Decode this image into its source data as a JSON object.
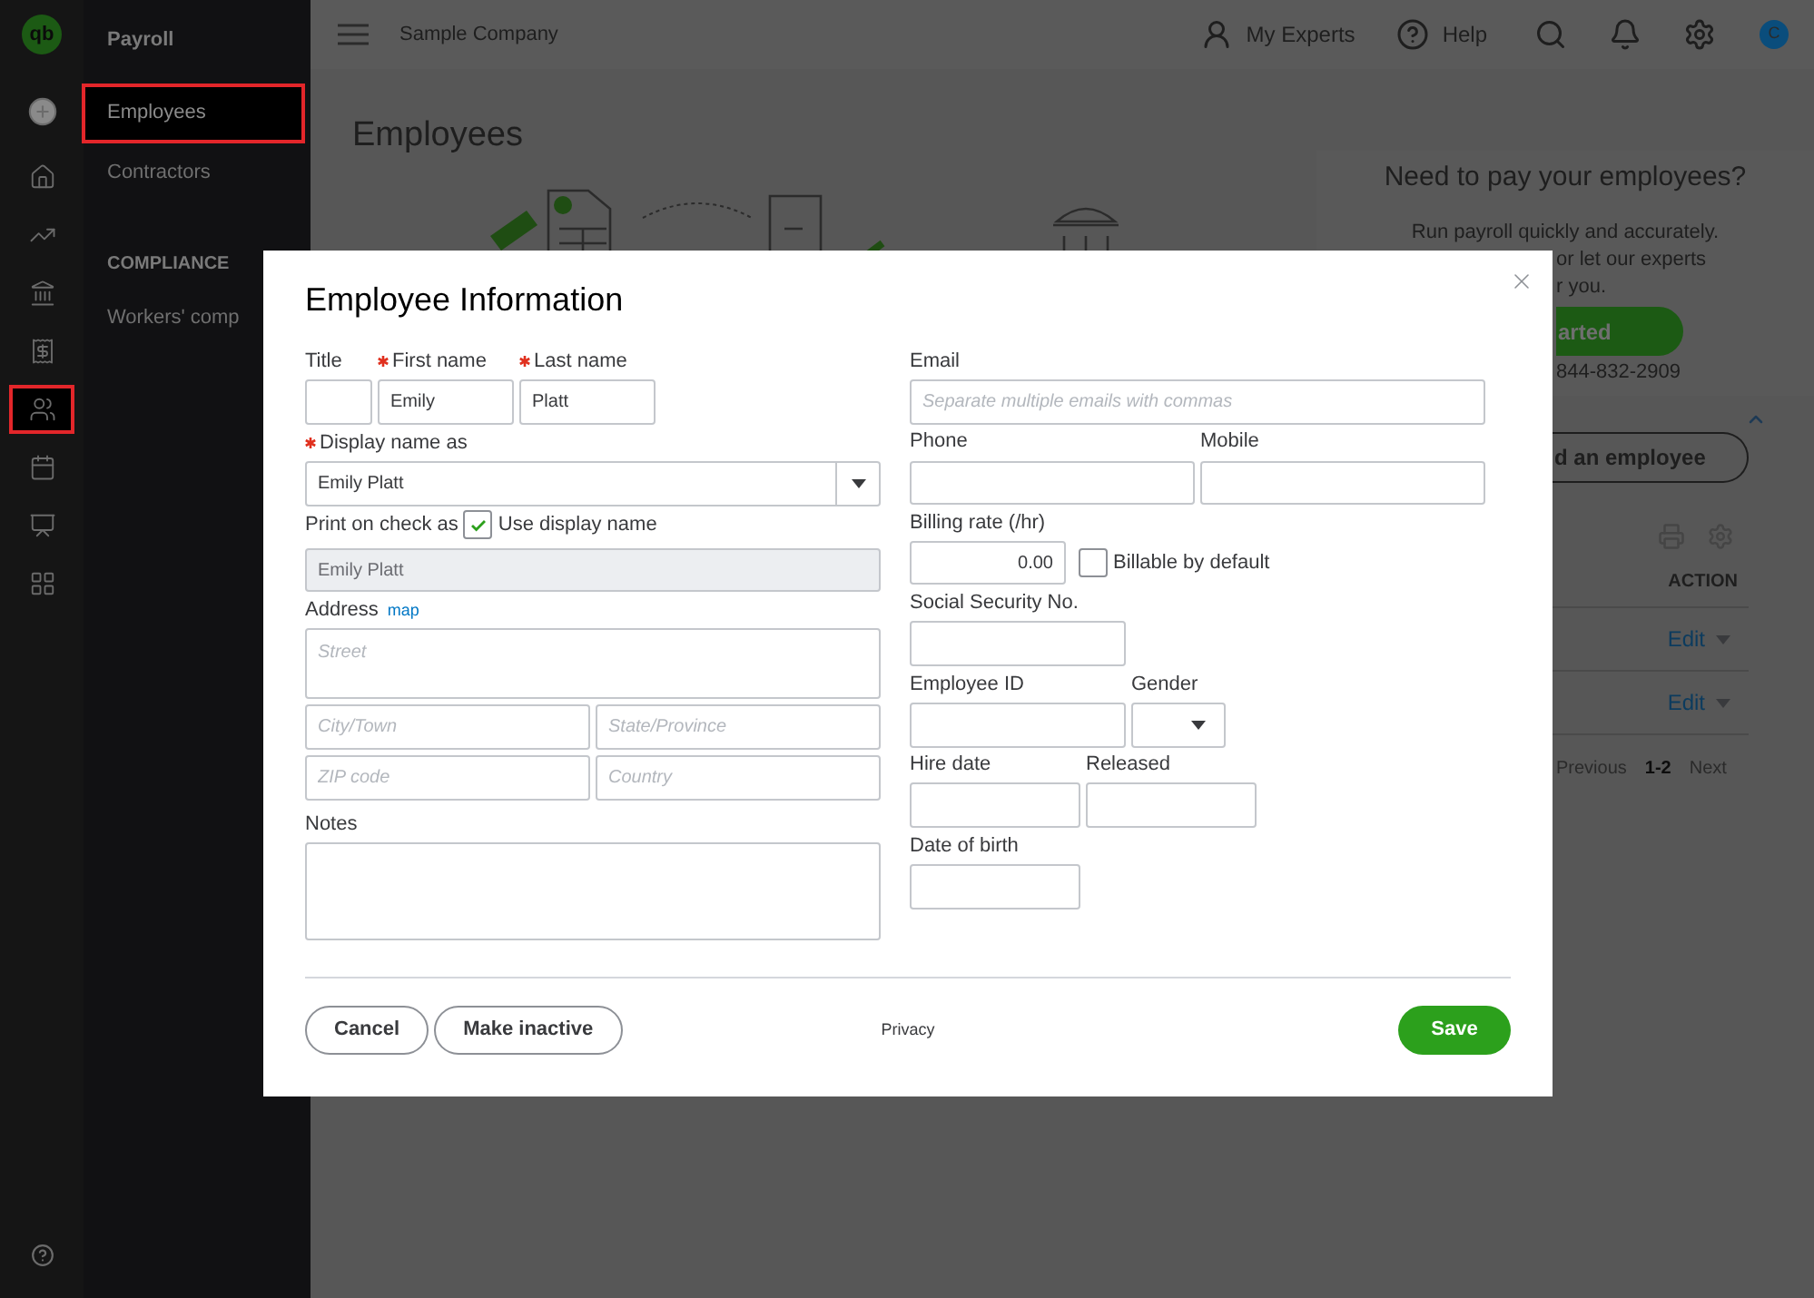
{
  "rail": {
    "logo": "qb",
    "items": [
      {
        "selected": false
      },
      {
        "selected": false
      },
      {
        "selected": false
      },
      {
        "selected": false
      },
      {
        "selected": false
      },
      {
        "selected": true
      },
      {
        "selected": false
      },
      {
        "selected": false
      },
      {
        "selected": false
      }
    ]
  },
  "nav": {
    "title": "Payroll",
    "items": [
      {
        "label": "Employees",
        "selected": true
      },
      {
        "label": "Contractors",
        "selected": false
      }
    ],
    "section": {
      "heading": "COMPLIANCE",
      "items": [
        {
          "label": "Workers' comp",
          "selected": false
        }
      ]
    }
  },
  "topbar": {
    "company": "Sample Company",
    "experts": "My Experts",
    "help": "Help",
    "avatar": "C"
  },
  "page": {
    "title": "Employees",
    "promo": {
      "title": "Need to pay your employees?",
      "line": "Run payroll quickly and accurately.",
      "fragments": [
        "or let our experts",
        "r you."
      ],
      "button": "arted",
      "phone": "844-832-2909"
    },
    "add_button": "d an employee",
    "table": {
      "action_header": "ACTION",
      "rows": [
        {
          "action": "Edit"
        },
        {
          "action": "Edit"
        }
      ]
    },
    "pagination": [
      {
        "label": "Previous",
        "disabled": true
      },
      {
        "label": "1-2",
        "disabled": false
      },
      {
        "label": "Next",
        "disabled": true
      }
    ]
  },
  "dialog": {
    "title": "Employee Information",
    "title_field": {
      "label": "Title",
      "required": false
    },
    "first_name": {
      "label": "First name",
      "required": true,
      "value": "Emily"
    },
    "last_name": {
      "label": "Last name",
      "required": true,
      "value": "Platt"
    },
    "display_name": {
      "label": "Display name as",
      "required": true,
      "value": "Emily Platt"
    },
    "print_on_check": {
      "label": "Print on check as",
      "checkbox_label": "Use display name",
      "checked": true,
      "value": "Emily Platt",
      "disabled": true
    },
    "address": {
      "label": "Address",
      "link": "map",
      "street_placeholder": "Street",
      "city_placeholder": "City/Town",
      "state_placeholder": "State/Province",
      "zip_placeholder": "ZIP code",
      "country_placeholder": "Country"
    },
    "notes": {
      "label": "Notes"
    },
    "email": {
      "label": "Email",
      "placeholder": "Separate multiple emails with commas"
    },
    "phone": {
      "label": "Phone"
    },
    "mobile": {
      "label": "Mobile"
    },
    "billing_rate": {
      "label": "Billing rate (/hr)",
      "value": "0.00",
      "checkbox_label": "Billable by default",
      "checked": false
    },
    "ssn": {
      "label": "Social Security No."
    },
    "employee_id": {
      "label": "Employee ID"
    },
    "gender": {
      "label": "Gender"
    },
    "hire_date": {
      "label": "Hire date"
    },
    "released": {
      "label": "Released"
    },
    "date_of_birth": {
      "label": "Date of birth"
    },
    "buttons": {
      "cancel": "Cancel",
      "make_inactive": "Make inactive",
      "privacy": "Privacy",
      "save": "Save"
    }
  }
}
